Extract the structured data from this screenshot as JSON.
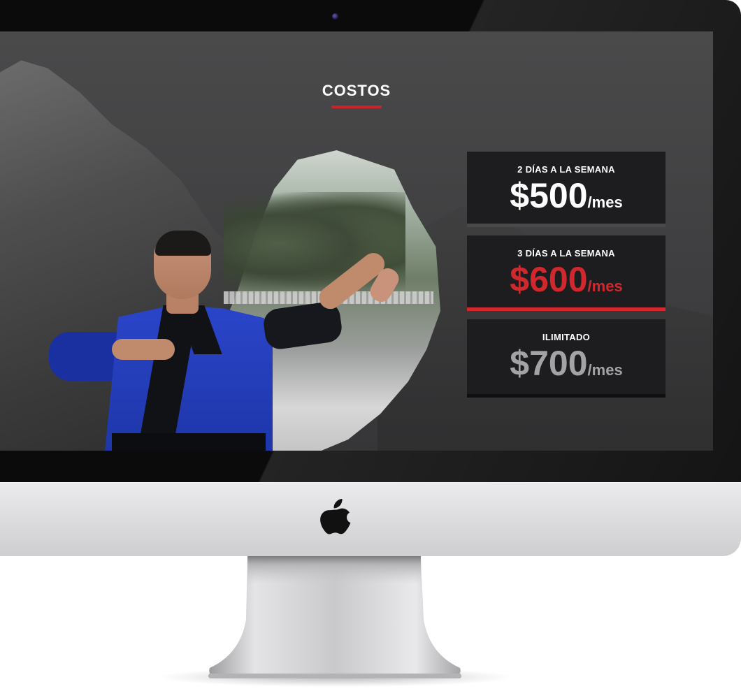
{
  "section": {
    "title": "COSTOS"
  },
  "pricing": [
    {
      "plan": "2 DÍAS A LA SEMANA",
      "amount": "$500",
      "period": "/mes",
      "accent": "#ffffff"
    },
    {
      "plan": "3 DÍAS A LA SEMANA",
      "amount": "$600",
      "period": "/mes",
      "accent": "#d1282e"
    },
    {
      "plan": "ILIMITADO",
      "amount": "$700",
      "period": "/mes",
      "accent": "#a3a3a5"
    }
  ],
  "theme": {
    "accent_red": "#c8242a",
    "card_background": "#1d1d1f"
  },
  "icons": {
    "monitor_logo": "apple-logo-icon",
    "camera": "camera-icon"
  }
}
